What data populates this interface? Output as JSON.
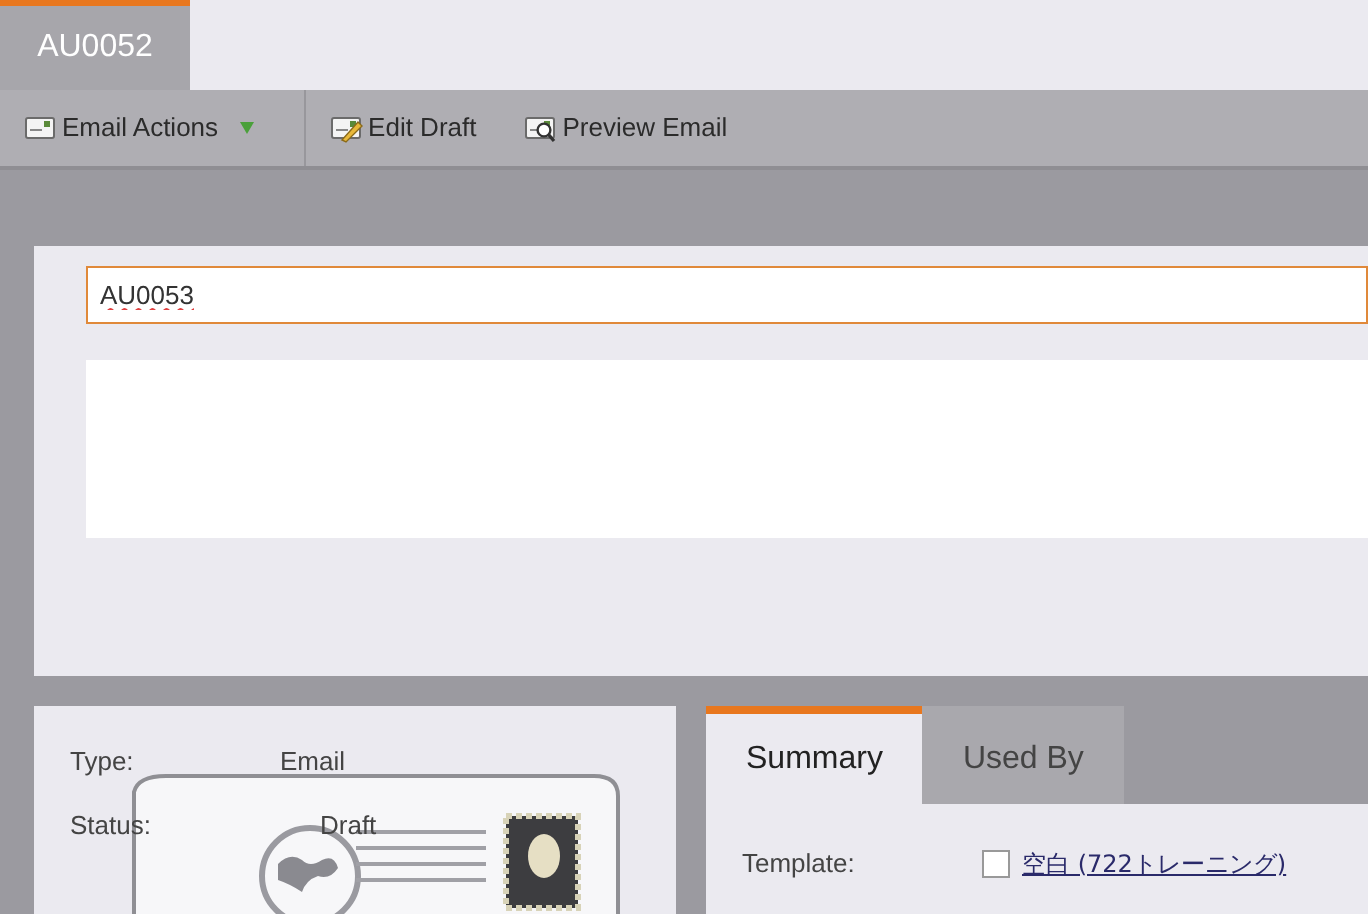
{
  "tabs": [
    {
      "label": "AU0052",
      "selected": true
    }
  ],
  "toolbar": [
    {
      "label": "Email Actions",
      "kind": "menu"
    },
    {
      "label": "Edit Draft",
      "kind": "button"
    },
    {
      "label": "Preview Email",
      "kind": "button"
    }
  ],
  "name_field": {
    "value": "AU0053"
  },
  "details": [
    {
      "label": "Type:",
      "value": "Email"
    },
    {
      "label": "Status:",
      "value": "Draft"
    }
  ],
  "summary_tabs": [
    {
      "label": "Summary",
      "selected": true
    },
    {
      "label": "Used By",
      "selected": false
    }
  ],
  "template": {
    "label": "Template:",
    "checked": false,
    "link": "空白 (722トレーニング)"
  }
}
